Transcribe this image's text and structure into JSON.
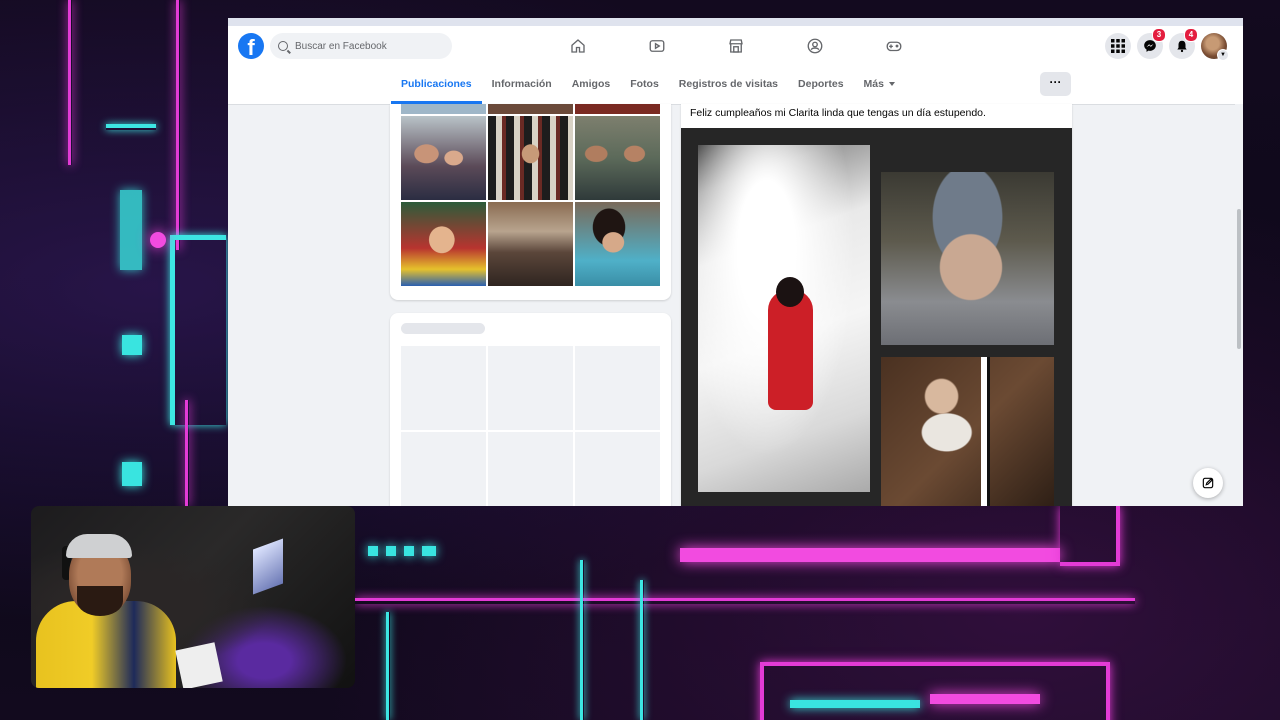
{
  "search": {
    "placeholder": "Buscar en Facebook"
  },
  "logo": {
    "letter": "f"
  },
  "nav_icons": [
    "home-icon",
    "video-icon",
    "marketplace-icon",
    "groups-icon",
    "gaming-icon"
  ],
  "right_icons": {
    "menu_icon": "grid-icon",
    "messenger_badge": "3",
    "notifications_badge": "4"
  },
  "tabs": [
    {
      "label": "Publicaciones",
      "active": true
    },
    {
      "label": "Información"
    },
    {
      "label": "Amigos"
    },
    {
      "label": "Fotos"
    },
    {
      "label": "Registros de visitas"
    },
    {
      "label": "Deportes"
    },
    {
      "label": "Más"
    }
  ],
  "more_button": "···",
  "post": {
    "text": "Feliz cumpleaños mi Clarita linda que tengas un día estupendo."
  },
  "colors": {
    "brand": "#1877f2",
    "badge": "#e41e3f"
  }
}
